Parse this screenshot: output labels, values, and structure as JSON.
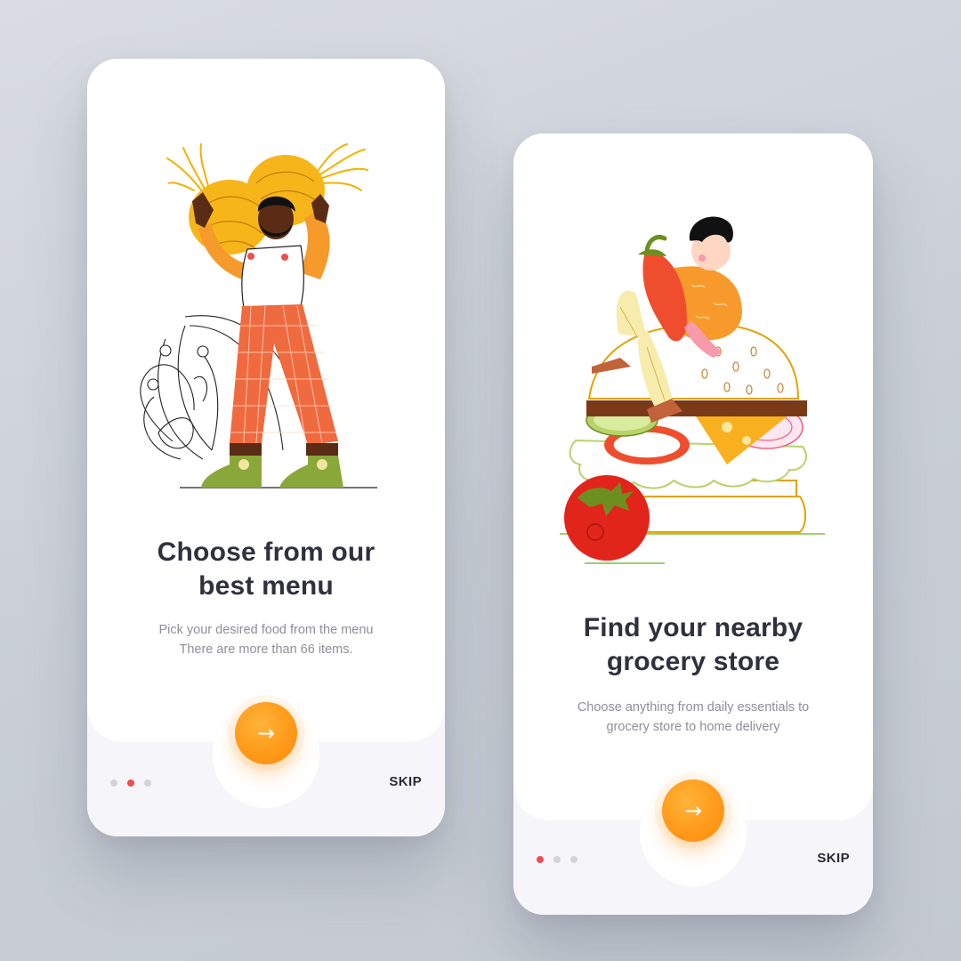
{
  "colors": {
    "accent": "#ff9a1a",
    "active_dot": "#ef4e4e",
    "inactive_dot": "#d3d3da",
    "title": "#30303f",
    "subtitle": "#8e8e99"
  },
  "screens": [
    {
      "title_lines": [
        "Choose from our",
        "best menu"
      ],
      "subtitle_lines": [
        "Pick your desired food from the menu",
        "There are more than 66 items."
      ],
      "next_icon": "arrow-right-icon",
      "skip_label": "SKIP",
      "active_page": 2,
      "page_count": 3
    },
    {
      "title_lines": [
        "Find your nearby",
        "grocery store"
      ],
      "subtitle_lines": [
        "Choose anything from daily essentials to",
        "grocery store to home delivery"
      ],
      "next_icon": "arrow-right-icon",
      "skip_label": "SKIP",
      "active_page": 1,
      "page_count": 3
    }
  ]
}
